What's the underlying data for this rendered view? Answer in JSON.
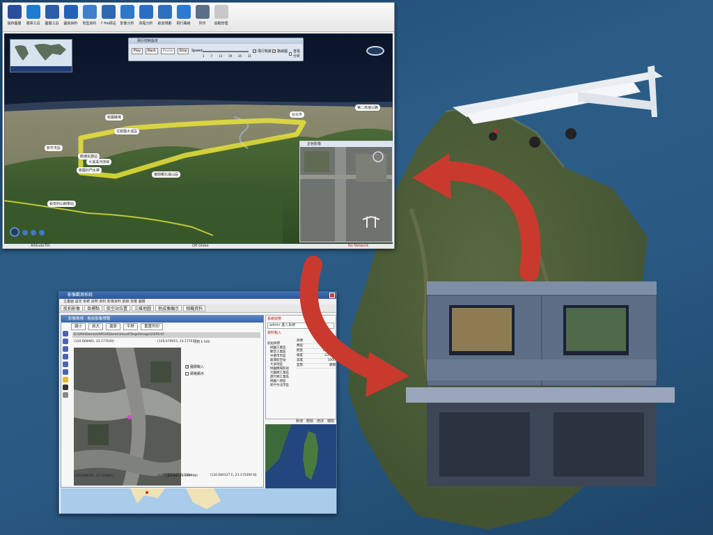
{
  "gis_window": {
    "toolbar": [
      {
        "label": "儲存圖層",
        "icon": "save-icon",
        "color": "#2a4e9c"
      },
      {
        "label": "選擇工具",
        "icon": "globe-icon",
        "color": "#1f7bd0"
      },
      {
        "label": "圖層工具",
        "icon": "layers-icon",
        "color": "#2d5da8"
      },
      {
        "label": "圖資資料",
        "icon": "wms-icon",
        "color": "#2460b8"
      },
      {
        "label": "地型資料",
        "icon": "terrain-icon",
        "color": "#3f7fcc"
      },
      {
        "label": "7 file標註",
        "icon": "pin-icon",
        "color": "#2e68b0"
      },
      {
        "label": "影像分析",
        "icon": "disc-icon",
        "color": "#2f77c8"
      },
      {
        "label": "高程分析",
        "icon": "globe-half-icon",
        "color": "#2a6ec2"
      },
      {
        "label": "航道規劃",
        "icon": "route-icon",
        "color": "#2f6fbf"
      },
      {
        "label": "飛行路線",
        "icon": "plane-icon",
        "color": "#2c79d0"
      },
      {
        "label": "列印",
        "icon": "print-icon",
        "color": "#5d6f88"
      },
      {
        "label": "追蹤管理",
        "icon": "document-icon",
        "color": "#c8c8c8"
      }
    ],
    "minimap_label": "",
    "nav_dialog": {
      "title": "飛行控制設定",
      "buttons": [
        "Play",
        "Back",
        "Pause",
        "Stop"
      ],
      "speed_label": "Speed",
      "speed_ticks": [
        "1",
        "7",
        "13",
        "19",
        "25",
        "31"
      ],
      "checkboxes": [
        {
          "label": "飛行軌跡",
          "checked": true
        },
        {
          "label": "路線圖",
          "checked": true
        },
        {
          "label": "查看分析",
          "checked": false
        }
      ]
    },
    "place_labels": [
      {
        "text": "桃園機場",
        "id": "label-taoyuan-airport"
      },
      {
        "text": "位桃園大溪區",
        "id": "label-daxi"
      },
      {
        "text": "新竹市區",
        "id": "label-hsinchu"
      },
      {
        "text": "觀塘氣體站",
        "id": "label-guantang"
      },
      {
        "text": "大溪溪河流域",
        "id": "label-daxi-river"
      },
      {
        "text": "桃園石門水庫",
        "id": "label-shimen"
      },
      {
        "text": "復興鄉北邊山區",
        "id": "label-fuxing"
      },
      {
        "text": "長安的山線車站",
        "id": "label-changan"
      },
      {
        "text": "台北市",
        "id": "label-taipei"
      },
      {
        "text": "第二高速公路",
        "id": "label-freeway"
      }
    ],
    "inset_title": "正射影像",
    "status": {
      "left": "Altitude",
      "left2": "Tilt",
      "center": "Off Globe",
      "right": "No Network"
    }
  },
  "image_window": {
    "title": "影像觀測系統",
    "menubar": "主畫面 設定 系統 說明 資料 影像資料 航線 測量 圖層",
    "tabs": [
      "航拍影像",
      "目標點",
      "航空站位置",
      "三維地圖",
      "熱成像顯示",
      "相機資料"
    ],
    "viewer": {
      "title": "影像檢視 : 航拍影像預覽",
      "buttons": [
        "縮小",
        "放大",
        "還原",
        "平移",
        "重置列印"
      ],
      "path": "D:\\UAV\\Demo\\UAPGUI\\Demo\\Visual\\TargetImage\\2\\456.tif",
      "coord_tl": "(120.668981, 23.177049)",
      "coord_tr": "(120.679915, 23.177077)",
      "scale": "比例 1:500",
      "coord_bl": "(120.668225, 23.169801)",
      "coord_br": "(120.681106, 23.169798)",
      "checkboxes": [
        {
          "label": "圖層輸入",
          "checked": true
        },
        {
          "label": "網格顯示",
          "checked": false
        }
      ],
      "footer_scale": "地面解析度 0.158m",
      "footer_coord": "(120.680127 E, 23.175490 N)"
    },
    "right_panel": {
      "head1": "系統狀態",
      "login": "admin 進入系統",
      "head2": "資料輸入",
      "tree": [
        "航拍目標",
        "桃園工業區",
        "觀音工業區",
        "中壢市市區",
        "龍潭航空站",
        "大溪地區",
        "桃園機場航站",
        "大園鄉工業區",
        "蘆竹鄉工業區",
        "桃園八德區",
        "新竹竹北市區"
      ],
      "props": [
        [
          "目標",
          "桃園"
        ],
        [
          "類型",
          "航拍"
        ],
        [
          "經度",
          "120.679"
        ],
        [
          "緯度",
          "23.176"
        ],
        [
          "高度",
          "1000"
        ],
        [
          "型態",
          "靜態"
        ]
      ],
      "footer": [
        "新增",
        "刪除",
        "修改",
        "關閉"
      ]
    }
  },
  "colors": {
    "ocean": "#2a5a83",
    "title_bar": "#2d5696",
    "arrow": "#c83a2e",
    "flight_path": "#e8e23a"
  }
}
